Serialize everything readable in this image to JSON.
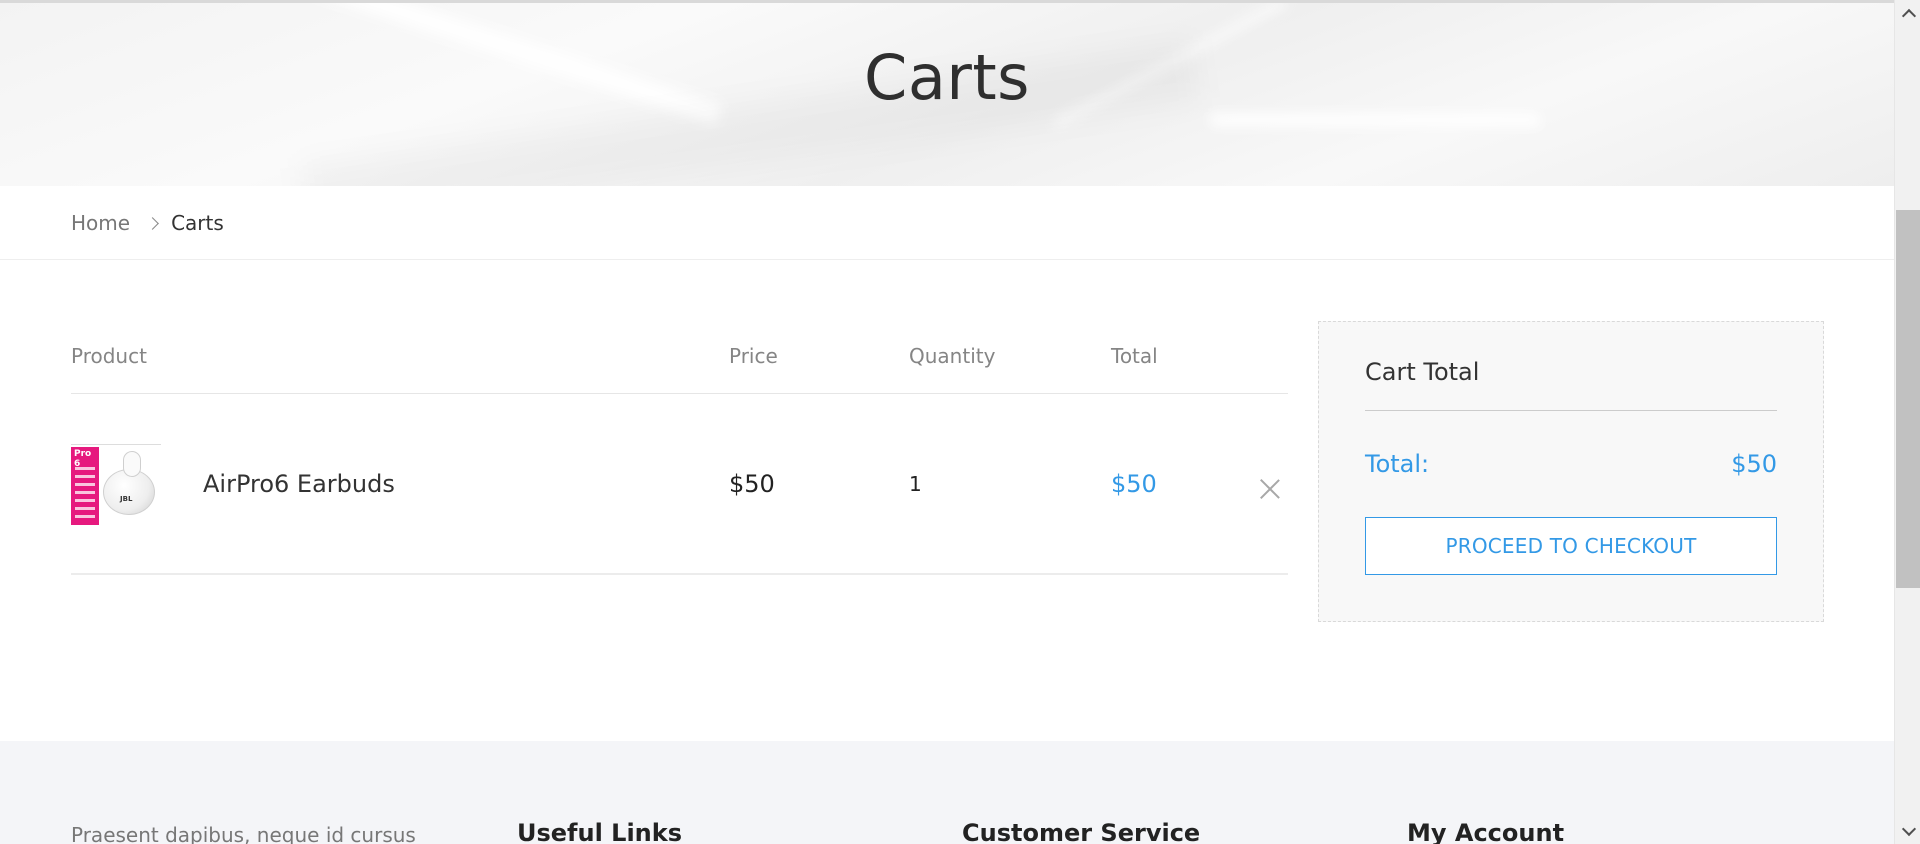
{
  "hero": {
    "title": "Carts"
  },
  "breadcrumb": {
    "home": "Home",
    "current": "Carts"
  },
  "cart": {
    "headers": {
      "product": "Product",
      "price": "Price",
      "quantity": "Quantity",
      "total": "Total"
    },
    "items": [
      {
        "image_icon": "earbuds-product-image",
        "name": "AirPro6 Earbuds",
        "price": "$50",
        "quantity": "1",
        "total": "$50",
        "remove_icon": "close-icon"
      }
    ]
  },
  "summary": {
    "title": "Cart Total",
    "total_label": "Total:",
    "total_value": "$50",
    "checkout_label": "PROCEED TO CHECKOUT"
  },
  "footer": {
    "about_text": "Praesent dapibus, neque id cursus",
    "headings": [
      "Useful Links",
      "Customer Service",
      "My Account"
    ]
  },
  "colors": {
    "accent": "#3399e6",
    "footer_bg": "#f4f5f8",
    "text": "#333333"
  }
}
